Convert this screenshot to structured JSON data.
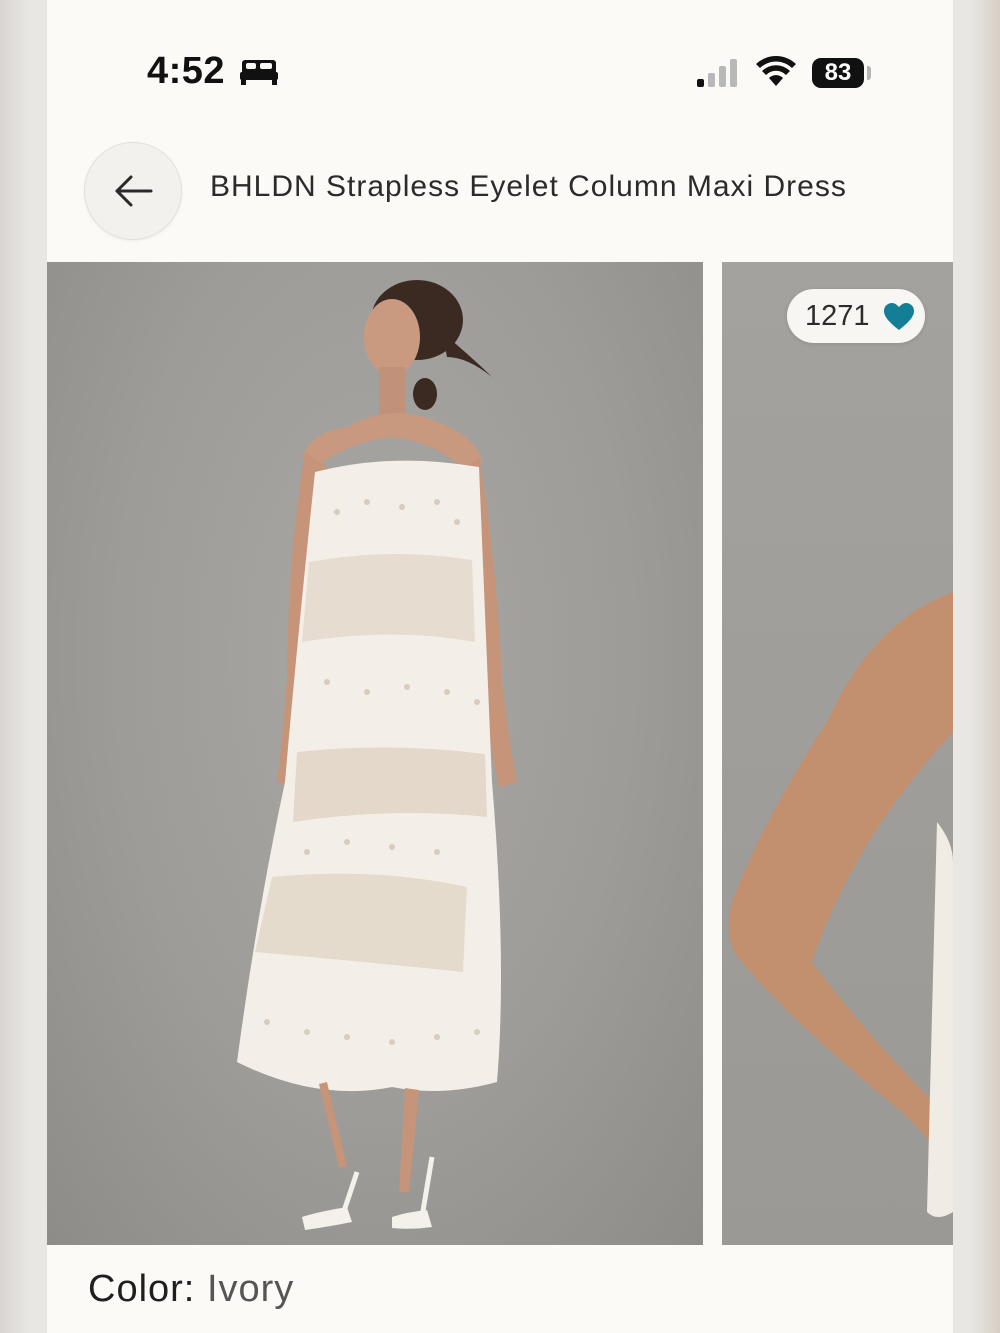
{
  "status_bar": {
    "time": "4:52",
    "battery": "83",
    "icons": [
      "bed-icon",
      "signal-icon",
      "wifi-icon",
      "battery-icon"
    ]
  },
  "header": {
    "title": "BHLDN Strapless Eyelet Column Maxi Dress",
    "back_icon": "arrow-left-icon"
  },
  "gallery": {
    "like_count": "1271",
    "like_icon": "heart-icon",
    "colors": {
      "accent": "#137f96"
    }
  },
  "product": {
    "color_label": "Color:",
    "color_value": "Ivory"
  }
}
